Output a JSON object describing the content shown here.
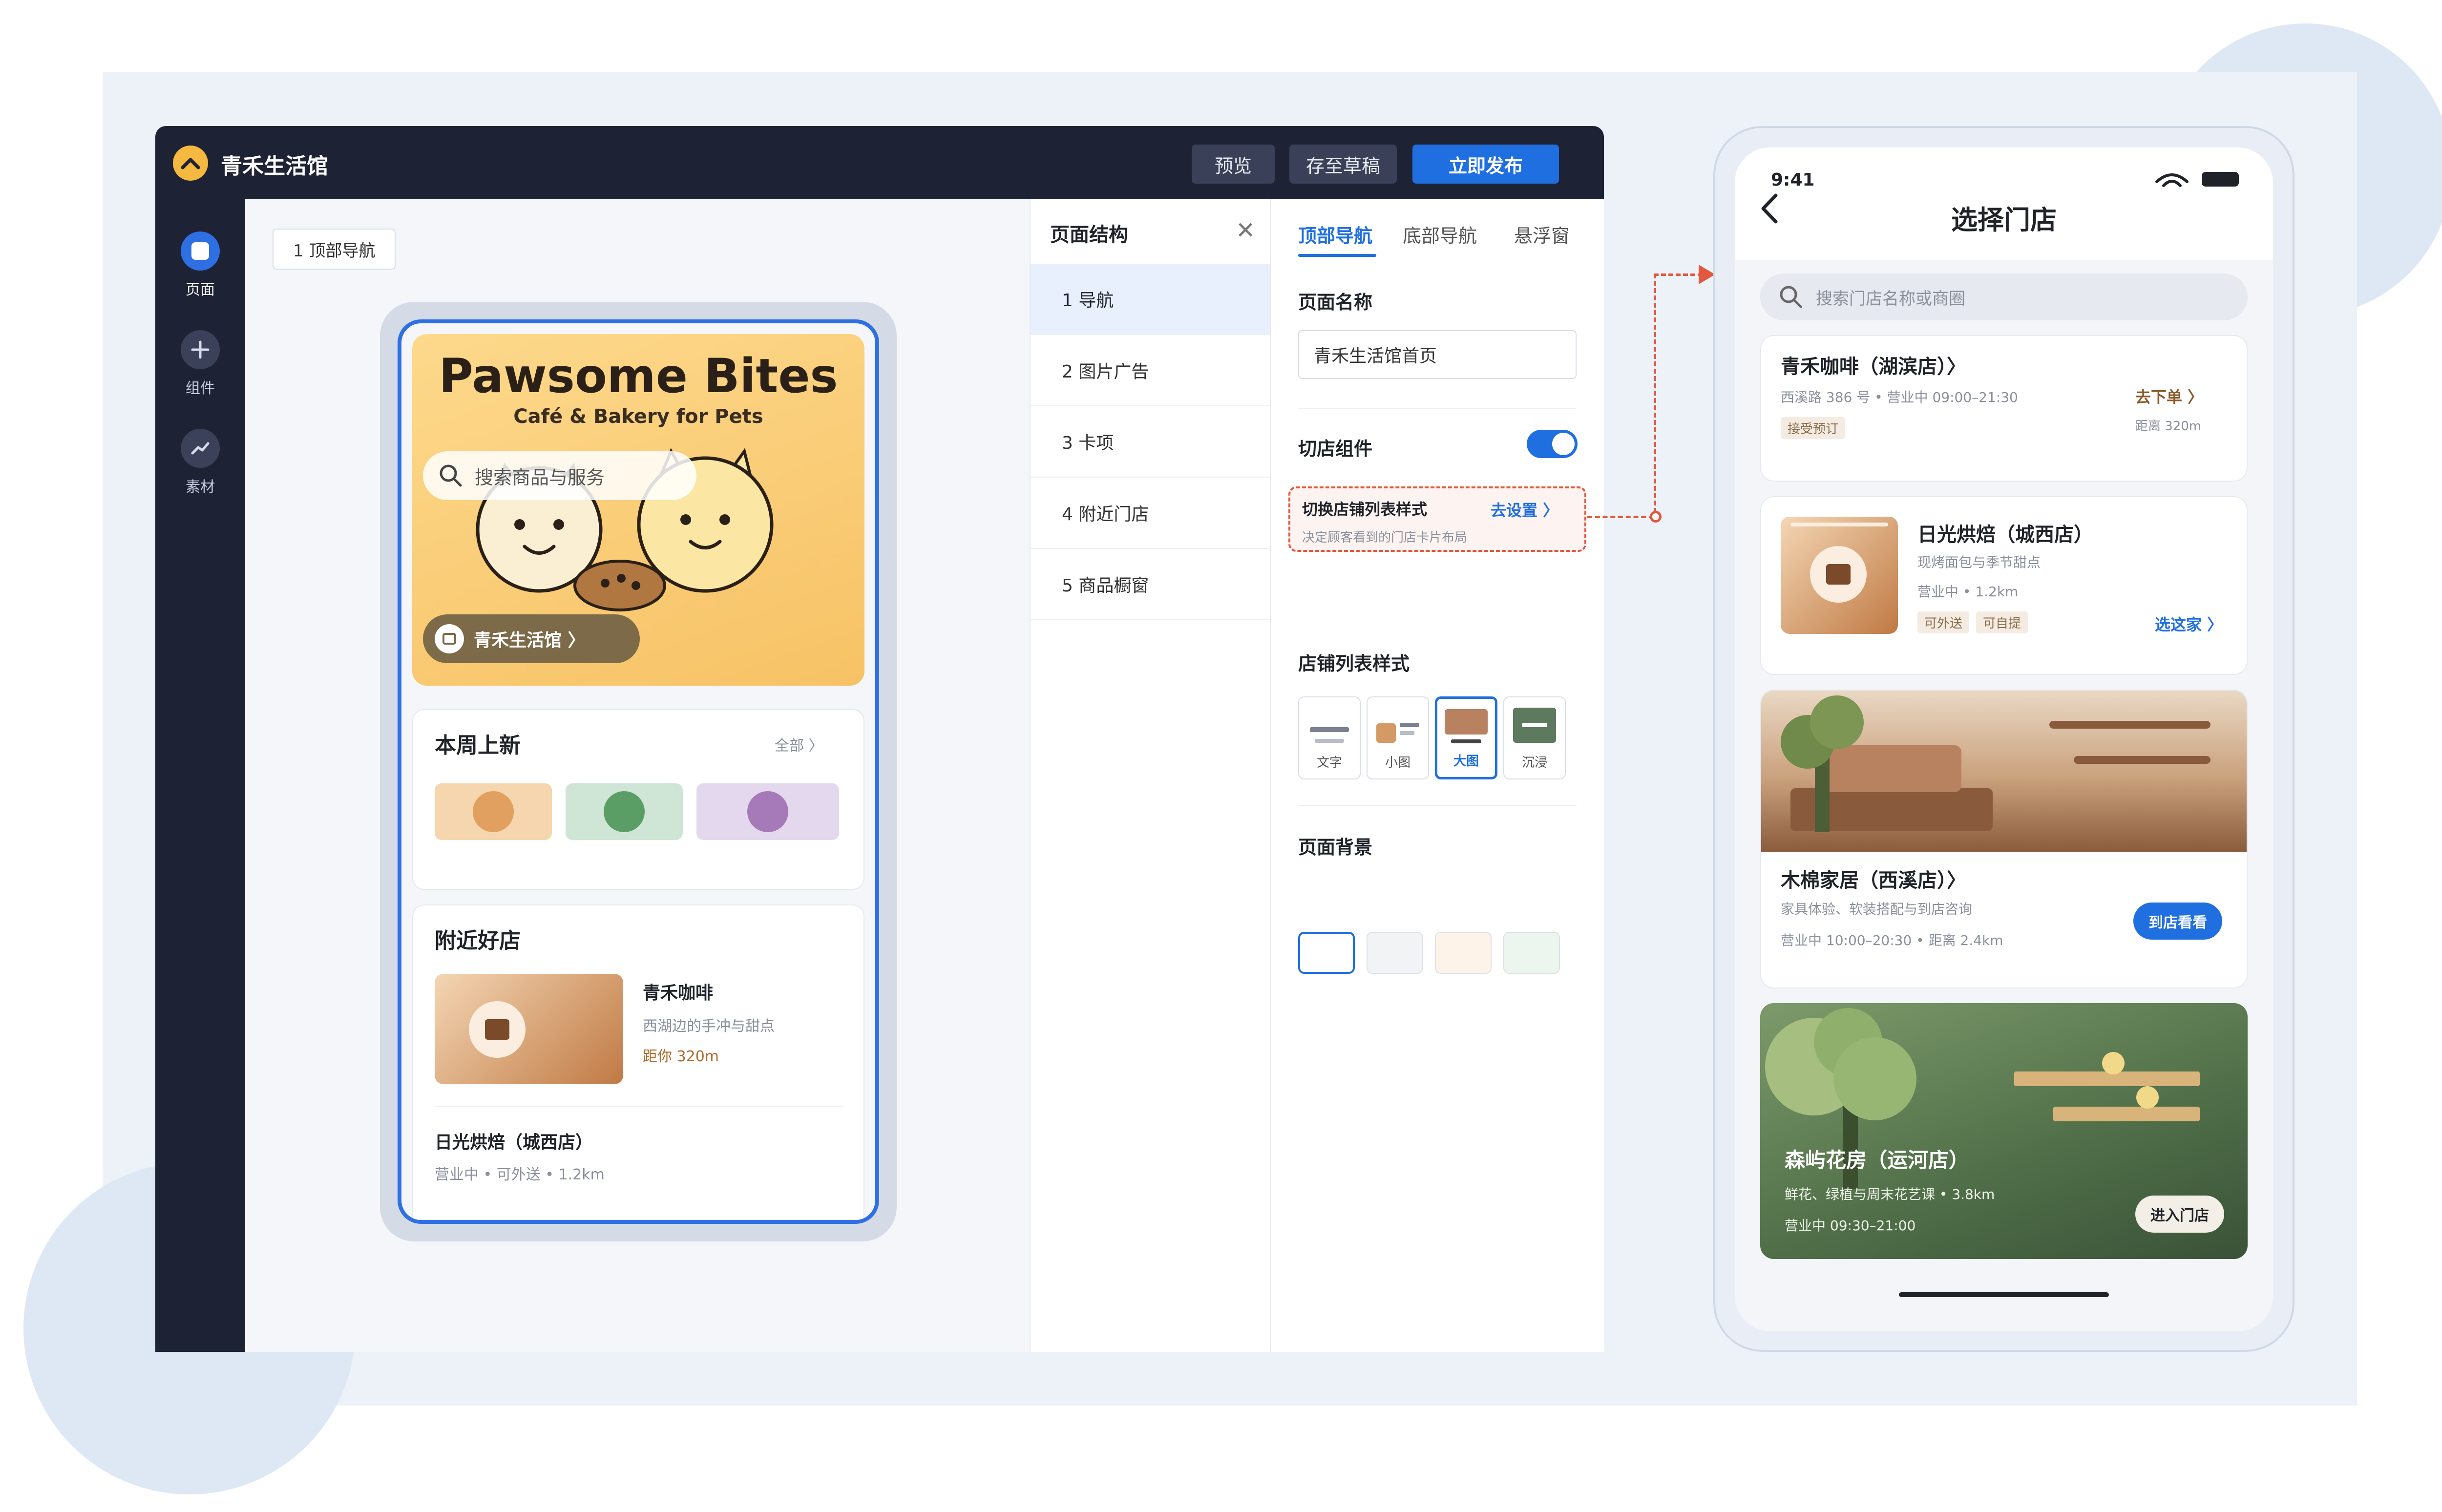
{
  "editor": {
    "brand": "青禾生活馆",
    "buttons": {
      "preview": "预览",
      "save_draft": "存至草稿",
      "publish": "立即发布"
    },
    "rail": [
      {
        "label": "页面",
        "icon": "page-icon"
      },
      {
        "label": "组件",
        "icon": "plus-icon"
      },
      {
        "label": "素材",
        "icon": "trend-icon"
      }
    ],
    "crumb": "1 顶部导航",
    "phone": {
      "hero_title": "Pawsome Bites",
      "hero_subtitle": "Café & Bakery for Pets",
      "search_placeholder": "搜索商品与服务",
      "store_pill": "青禾生活馆 〉",
      "new_title": "本周上新",
      "new_all": "全部 〉",
      "nearby_title": "附近好店",
      "store1_name": "青禾咖啡",
      "store1_desc": "西湖边的手冲与甜点",
      "store1_distance": "距你 320m",
      "store2_name": "日光烘焙（城西店）",
      "store2_meta": "营业中 • 可外送 • 1.2km"
    },
    "structure": {
      "title": "页面结构",
      "items": [
        "1 导航",
        "2 图片广告",
        "3 卡项",
        "4 附近门店",
        "5 商品橱窗"
      ]
    },
    "props": {
      "tabs": [
        "顶部导航",
        "底部导航",
        "悬浮窗"
      ],
      "page_name_label": "页面名称",
      "page_name_value": "青禾生活馆首页",
      "switch_label": "切店组件",
      "switch_on": true,
      "hint_title": "切换店铺列表样式",
      "hint_link": "去设置 〉",
      "hint_desc": "决定顾客看到的门店卡片布局",
      "list_style_label": "店铺列表样式",
      "list_styles": [
        "文字",
        "小图",
        "大图",
        "沉浸"
      ],
      "list_style_selected": "大图",
      "bg_label": "页面背景",
      "bg_swatches": [
        "#ffffff",
        "#f2f3f5",
        "#fdf3e8",
        "#edf6ee"
      ]
    }
  },
  "preview": {
    "time": "9:41",
    "title": "选择门店",
    "search_placeholder": "搜索门店名称或商圈",
    "stores": [
      {
        "name": "青禾咖啡（湖滨店）〉",
        "meta": "西溪路 386 号 • 营业中 09:00–21:30",
        "tags": [
          "接受预订"
        ],
        "action": "去下单 〉",
        "distance": "距离 320m"
      },
      {
        "name": "日光烘焙（城西店）",
        "desc": "现烤面包与季节甜点",
        "meta": "营业中 • 1.2km",
        "tags": [
          "可外送",
          "可自提"
        ],
        "action": "选这家 〉"
      },
      {
        "name": "木棉家居（西溪店）〉",
        "desc": "家具体验、软装搭配与到店咨询",
        "meta": "营业中 10:00–20:30 • 距离 2.4km",
        "action": "到店看看"
      },
      {
        "name": "森屿花房（运河店）",
        "desc": "鲜花、绿植与周末花艺课 • 3.8km",
        "meta": "营业中 09:30–21:00",
        "action": "进入门店"
      }
    ]
  },
  "colors": {
    "accent": "#1f6fe0",
    "dark": "#1e2235",
    "warn": "#e2583e",
    "brand": "#f5b93f"
  }
}
